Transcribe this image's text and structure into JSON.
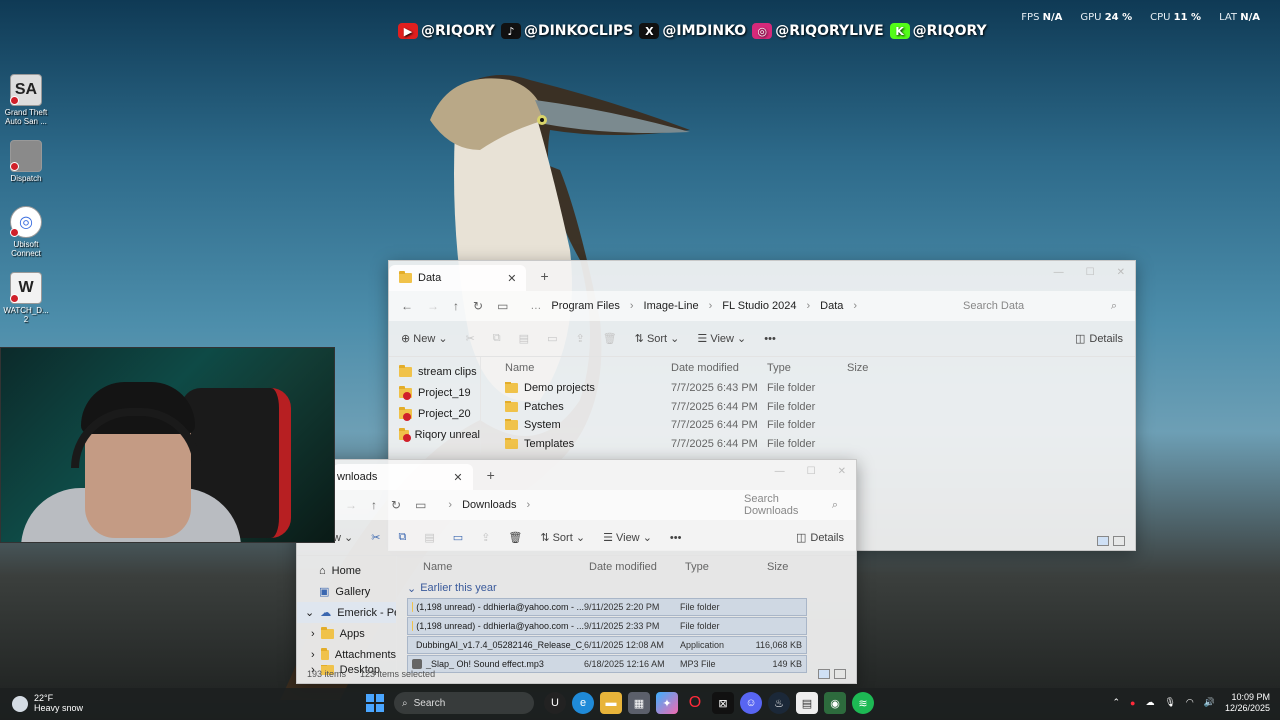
{
  "overlay": {
    "socials": [
      {
        "icon": "youtube-icon",
        "color": "#e01f1f",
        "handle": "@RIQORY"
      },
      {
        "icon": "tiktok-icon",
        "color": "#111111",
        "handle": "@DINKOCLIPS"
      },
      {
        "icon": "x-icon",
        "color": "#111111",
        "handle": "@IMDINKO"
      },
      {
        "icon": "instagram-icon",
        "color": "#d6297a",
        "handle": "@RIQORYLIVE"
      },
      {
        "icon": "kick-icon",
        "color": "#53fc18",
        "handle": "@RIQORY"
      }
    ],
    "stats": [
      {
        "label": "FPS",
        "value": "N/A"
      },
      {
        "label": "GPU",
        "value": "24 %"
      },
      {
        "label": "CPU",
        "value": "11 %"
      },
      {
        "label": "LAT",
        "value": "N/A"
      }
    ]
  },
  "desktop": {
    "icons": [
      {
        "label": "Grand Theft Auto San ...",
        "glyph": "SA"
      },
      {
        "label": "Dispatch",
        "glyph": ""
      },
      {
        "label": "Ubisoft Connect",
        "glyph": "◎"
      },
      {
        "label": "WATCH_D... 2",
        "glyph": "W"
      }
    ]
  },
  "window_data": {
    "tab_title": "Data",
    "breadcrumbs": [
      "Program Files",
      "Image-Line",
      "FL Studio 2024",
      "Data"
    ],
    "search_placeholder": "Search Data",
    "toolbar": {
      "new": "New",
      "sort": "Sort",
      "view": "View",
      "more": "•••",
      "details": "Details"
    },
    "nav": [
      "stream clips",
      "Project_19",
      "Project_20",
      "Riqory unreal"
    ],
    "columns": {
      "name": "Name",
      "date": "Date modified",
      "type": "Type",
      "size": "Size"
    },
    "rows": [
      {
        "name": "Demo projects",
        "date": "7/7/2025 6:43 PM",
        "type": "File folder",
        "size": ""
      },
      {
        "name": "Patches",
        "date": "7/7/2025 6:44 PM",
        "type": "File folder",
        "size": ""
      },
      {
        "name": "System",
        "date": "7/7/2025 6:44 PM",
        "type": "File folder",
        "size": ""
      },
      {
        "name": "Templates",
        "date": "7/7/2025 6:44 PM",
        "type": "File folder",
        "size": ""
      }
    ]
  },
  "window_downloads": {
    "tab_title": "wnloads",
    "breadcrumbs": [
      "Downloads"
    ],
    "search_placeholder": "Search Downloads",
    "toolbar": {
      "new": "w",
      "sort": "Sort",
      "view": "View",
      "more": "•••",
      "details": "Details"
    },
    "nav": [
      "Home",
      "Gallery",
      "Emerick - Perso",
      "Apps",
      "Attachments",
      "Desktop"
    ],
    "columns": {
      "name": "Name",
      "date": "Date modified",
      "type": "Type",
      "size": "Size"
    },
    "group": "Earlier this year",
    "rows": [
      {
        "name": "(1,198 unread) - ddhierla@yahoo.com - ...",
        "date": "9/11/2025 2:20 PM",
        "type": "File folder",
        "size": ""
      },
      {
        "name": "(1,198 unread) - ddhierla@yahoo.com - ...",
        "date": "9/11/2025 2:33 PM",
        "type": "File folder",
        "size": ""
      },
      {
        "name": "DubbingAI_v1.7.4_05282146_Release_C_S...",
        "date": "6/11/2025 12:08 AM",
        "type": "Application",
        "size": "116,068 KB"
      },
      {
        "name": "_Slap_ Oh! Sound effect.mp3",
        "date": "6/18/2025 12:16 AM",
        "type": "MP3 File",
        "size": "149 KB"
      }
    ],
    "status": {
      "items": "193 items",
      "selected": "123 items selected"
    }
  },
  "taskbar": {
    "weather_temp": "22°F",
    "weather_desc": "Heavy snow",
    "search_placeholder": "Search",
    "time": "10:09 PM",
    "date": "12/26/2025"
  }
}
